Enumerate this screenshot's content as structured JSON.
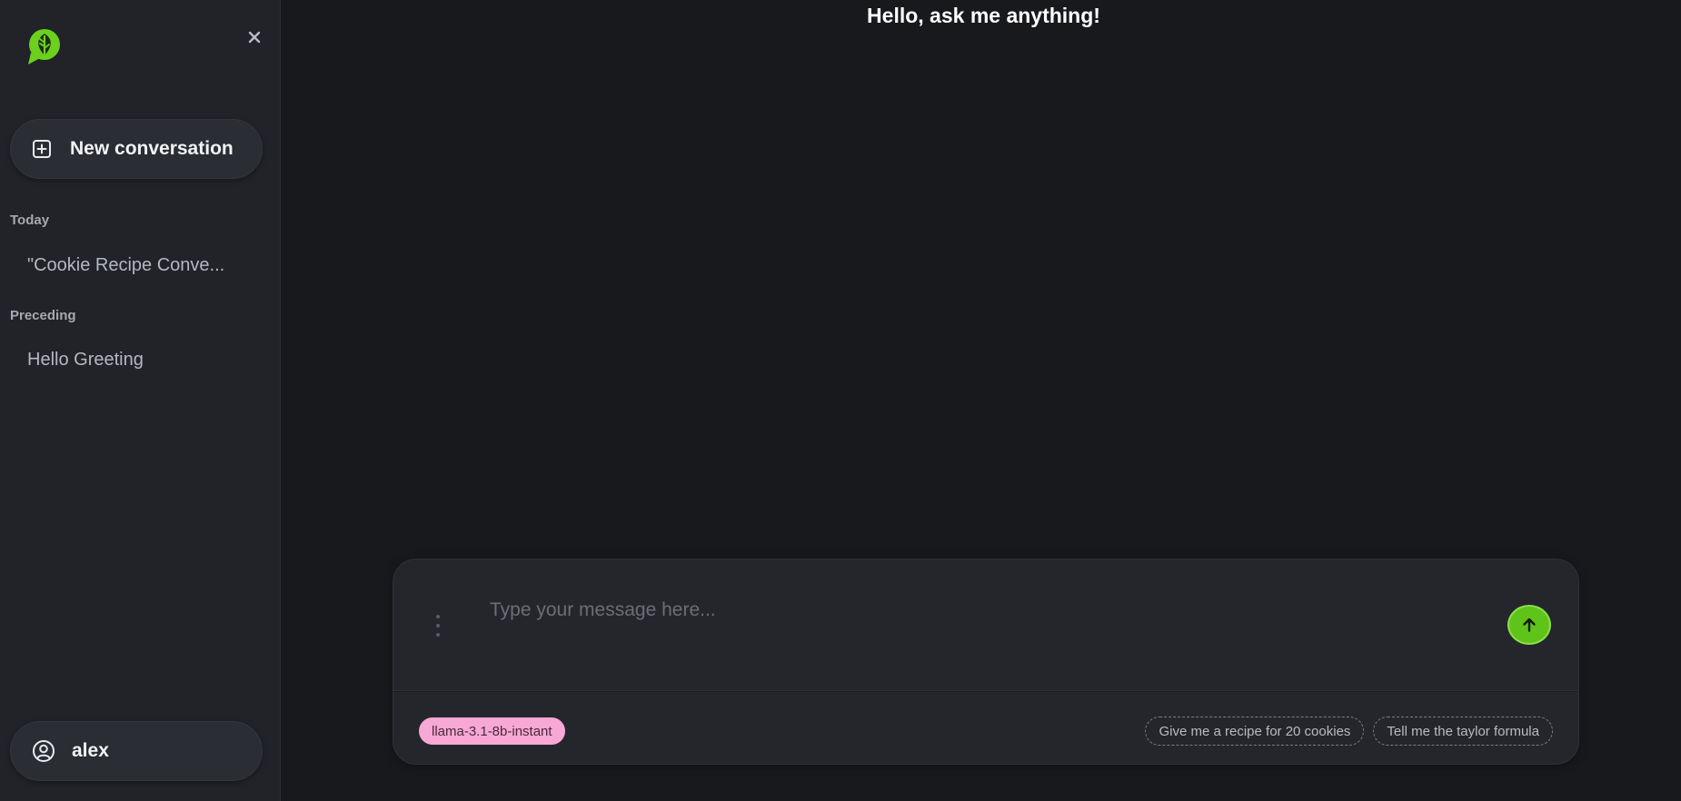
{
  "sidebar": {
    "new_conversation_label": "New conversation",
    "sections": [
      {
        "title": "Today",
        "items": [
          {
            "label": "\"Cookie Recipe Conve..."
          }
        ]
      },
      {
        "title": "Preceding",
        "items": [
          {
            "label": "Hello Greeting"
          }
        ]
      }
    ],
    "user_name": "alex"
  },
  "main": {
    "greeting": "Hello, ask me anything!",
    "composer": {
      "placeholder": "Type your message here...",
      "model": "llama-3.1-8b-instant",
      "suggestions": [
        "Give me a recipe for 20 cookies",
        "Tell me the taylor formula"
      ]
    }
  },
  "colors": {
    "accent": "#5fc31a",
    "sidebar_bg": "#212328",
    "main_bg": "#18191d",
    "model_badge": "#f7a8d4"
  },
  "icons": {
    "logo": "leaf-chat-logo-icon",
    "close": "close-icon",
    "new": "plus-square-icon",
    "user": "user-circle-icon",
    "send": "arrow-up-icon",
    "drag": "drag-handle-icon"
  }
}
